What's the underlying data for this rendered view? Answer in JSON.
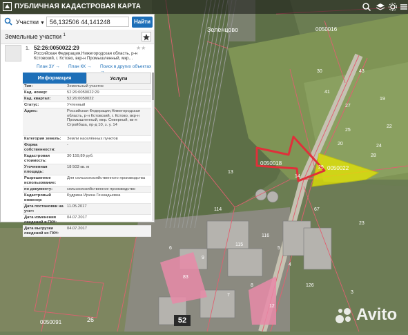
{
  "app": {
    "title": "ПУБЛИЧНАЯ КАДАСТРОВАЯ КАРТА",
    "search_type": "Участки",
    "search_value": "56,132506 44,141248",
    "find_label": "Найти"
  },
  "panel": {
    "section_title": "Земельные участки",
    "section_count": "1",
    "item_number": "1.",
    "cadastral_number": "52:26:0050022:29",
    "address_short": "Российская Федерация,Нижегородская область, р-н Кстовский, г. Кстово, вкр-н Промышленный, мкр…",
    "links": [
      "План ЗУ →",
      "План КК →",
      "Поиск в других объектах →"
    ],
    "tabs": [
      "Информация",
      "Услуги"
    ],
    "properties": [
      {
        "key": "Тип:",
        "value": "Земельный участок"
      },
      {
        "key": "Кад. номер:",
        "value": "52:26:0050022:29"
      },
      {
        "key": "Кад. квартал:",
        "value": "52:26:0050022"
      },
      {
        "key": "Статус:",
        "value": "Учтенный"
      },
      {
        "key": "Адрес:",
        "value": "Российская Федерация,Нижегородская область, р-н Кстовский, г. Кстово, вкр-н Промышленный, мкр. Северный, кв-л Стройбаза, пр-д 10, з. у. 14"
      },
      {
        "key": "Категория земель:",
        "value": "Земли населённых пунктов"
      },
      {
        "key": "Форма собственности:",
        "value": "-"
      },
      {
        "key": "Кадастровая стоимость:",
        "value": "30 159,89 руб."
      },
      {
        "key": "Уточненная площадь:",
        "value": "18 503 кв. м"
      },
      {
        "key": "Разрешенное использование:",
        "value": "Для сельскохозяйственного производства"
      },
      {
        "key": "по документу:",
        "value": "сельскохозяйственное производство"
      },
      {
        "key": "Кадастровый инженер:",
        "value": "Кудрина Ирина Геннадьевна"
      },
      {
        "key": "Дата постановки на учет:",
        "value": "11.05.2017"
      },
      {
        "key": "Дата изменения сведений в ГКН:",
        "value": "04.07.2017"
      },
      {
        "key": "Дата выгрузки сведений из ГКН:",
        "value": "04.07.2017"
      }
    ]
  },
  "map": {
    "labels": [
      "Зеленцово",
      "0050018",
      "0050022",
      "0050016",
      "0050091",
      "29",
      "28",
      "26",
      "14",
      "126",
      "52",
      "13",
      "12",
      "20",
      "25",
      "114",
      "116",
      "115",
      "83",
      "6",
      "9",
      "5",
      "4",
      "3",
      "7",
      "8",
      "67",
      "23",
      "30",
      "41",
      "43",
      "19",
      "22",
      "27",
      "24"
    ],
    "road_badge": "52",
    "watermark": "Avito"
  },
  "colors": {
    "accent": "#1d6fb8",
    "parcel_fill": "#e6e600",
    "arrow": "#e0303a",
    "boundary": "#e06070"
  }
}
